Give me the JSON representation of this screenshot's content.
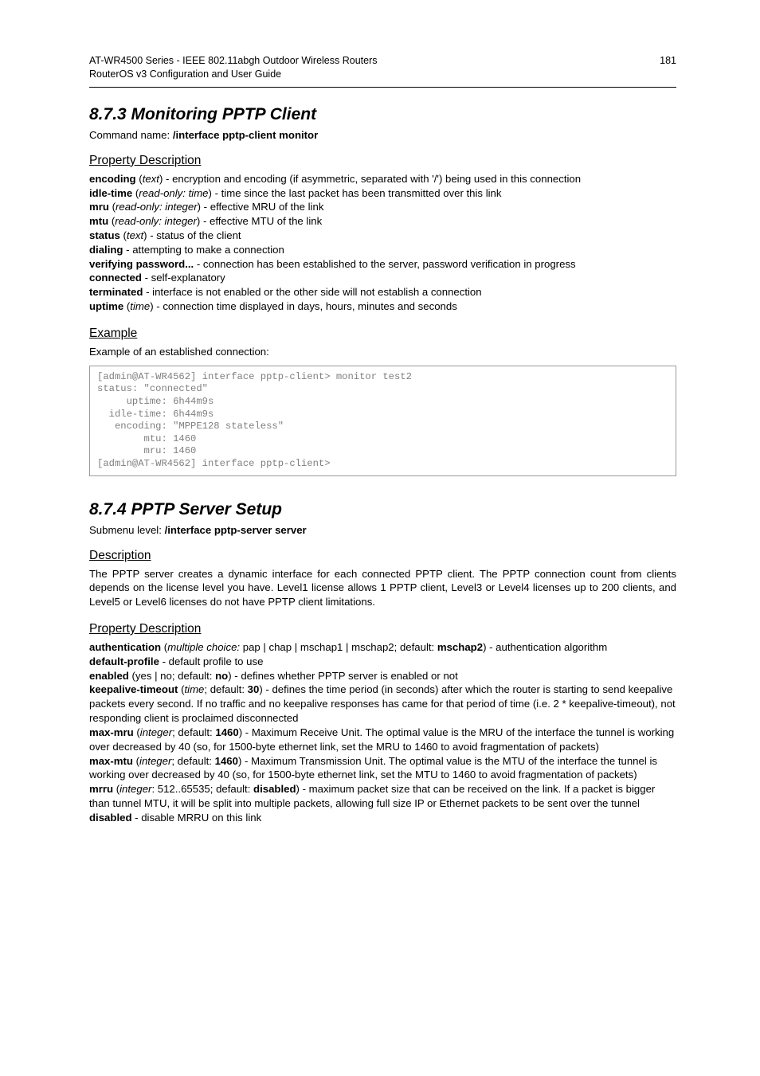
{
  "header": {
    "line1": "AT-WR4500 Series - IEEE 802.11abgh Outdoor Wireless Routers",
    "line2": "RouterOS v3 Configuration and User Guide",
    "page_number": "181"
  },
  "sections": {
    "monitor": {
      "number_title": "8.7.3  Monitoring PPTP Client",
      "command_label": "Command name: ",
      "command_value": "/interface pptp-client monitor",
      "props_heading": "Property Description",
      "props": {
        "encoding_name": "encoding",
        "encoding_type": "text",
        "encoding_desc": ") - encryption and encoding (if asymmetric, separated with '/') being used in this connection",
        "idle_name": "idle-time",
        "idle_type": "read-only: time",
        "idle_desc": ") - time since the last packet has been transmitted over this link",
        "mru_name": "mru",
        "mru_type": "read-only: integer",
        "mru_desc": ") - effective MRU of the link",
        "mtu_name": "mtu",
        "mtu_type": "read-only: integer",
        "mtu_desc": ") - effective MTU of the link",
        "status_name": "status",
        "status_type": "text",
        "status_desc": ") - status of the client",
        "dialing_name": "dialing",
        "dialing_desc": " - attempting to make a connection",
        "verify_name": "verifying password...",
        "verify_desc": " - connection has been established to the server, password verification in progress",
        "connected_name": "connected",
        "connected_desc": " - self-explanatory",
        "terminated_name": "terminated",
        "terminated_desc": " - interface is not enabled or the other side will not establish a connection",
        "uptime_name": "uptime",
        "uptime_type": "time",
        "uptime_desc": ") - connection time displayed in days, hours, minutes and seconds"
      },
      "example_heading": "Example",
      "example_intro": "Example of an established connection:",
      "code": "[admin@AT-WR4562] interface pptp-client> monitor test2\nstatus: \"connected\"\n     uptime: 6h44m9s\n  idle-time: 6h44m9s\n   encoding: \"MPPE128 stateless\"\n        mtu: 1460\n        mru: 1460\n[admin@AT-WR4562] interface pptp-client>"
    },
    "server": {
      "number_title": "8.7.4  PPTP Server Setup",
      "submenu_label": "Submenu level: ",
      "submenu_value": "/interface pptp-server server",
      "desc_heading": "Description",
      "description": "The PPTP server creates a dynamic interface for each connected PPTP client. The PPTP connection count from clients depends on the license level you have. Level1 license allows 1 PPTP client, Level3 or Level4 licenses up to 200 clients, and Level5 or Level6 licenses do not have PPTP client limitations.",
      "props_heading": "Property Description",
      "props": {
        "auth_name": "authentication",
        "auth_type": "multiple choice:",
        "auth_options": " pap | chap | mschap1 | mschap2; default: ",
        "auth_default": "mschap2",
        "auth_desc": ") - authentication algorithm",
        "defprof_name": "default-profile",
        "defprof_desc": " - default profile to use",
        "enabled_name": "enabled",
        "enabled_opts": " (yes | no; default: ",
        "enabled_default": "no",
        "enabled_desc": ") - defines whether PPTP server is enabled or not",
        "keep_name": "keepalive-timeout",
        "keep_type": "time",
        "keep_deflabel": "; default: ",
        "keep_default": "30",
        "keep_desc": ") - defines the time period (in seconds) after which the router is starting to send keepalive packets every second. If no traffic and no keepalive responses has came for that period of time (i.e. 2 * keepalive-timeout), not responding client is proclaimed disconnected",
        "maxmru_name": "max-mru",
        "maxmru_type": "integer",
        "maxmru_deflabel": "; default: ",
        "maxmru_default": "1460",
        "maxmru_desc": ") - Maximum Receive Unit. The optimal value is the MRU of the interface the tunnel is working over decreased by 40 (so, for 1500-byte ethernet link, set the MRU to 1460 to avoid fragmentation of packets)",
        "maxmtu_name": "max-mtu",
        "maxmtu_type": "integer",
        "maxmtu_deflabel": "; default: ",
        "maxmtu_default": "1460",
        "maxmtu_desc": ") - Maximum Transmission Unit. The optimal value is the MTU of the interface the tunnel is working over decreased by 40 (so, for 1500-byte ethernet link, set the MTU to 1460 to avoid fragmentation of packets)",
        "mrru_name": "mrru",
        "mrru_type": "integer",
        "mrru_range": ": 512..65535; default: ",
        "mrru_default": "disabled",
        "mrru_desc": ") - maximum packet size that can be received on the link. If a packet is bigger than tunnel MTU, it will be split into multiple packets, allowing full size IP or Ethernet packets to be sent over the tunnel",
        "disabled_name": "disabled",
        "disabled_desc": " - disable MRRU on this link"
      }
    }
  }
}
